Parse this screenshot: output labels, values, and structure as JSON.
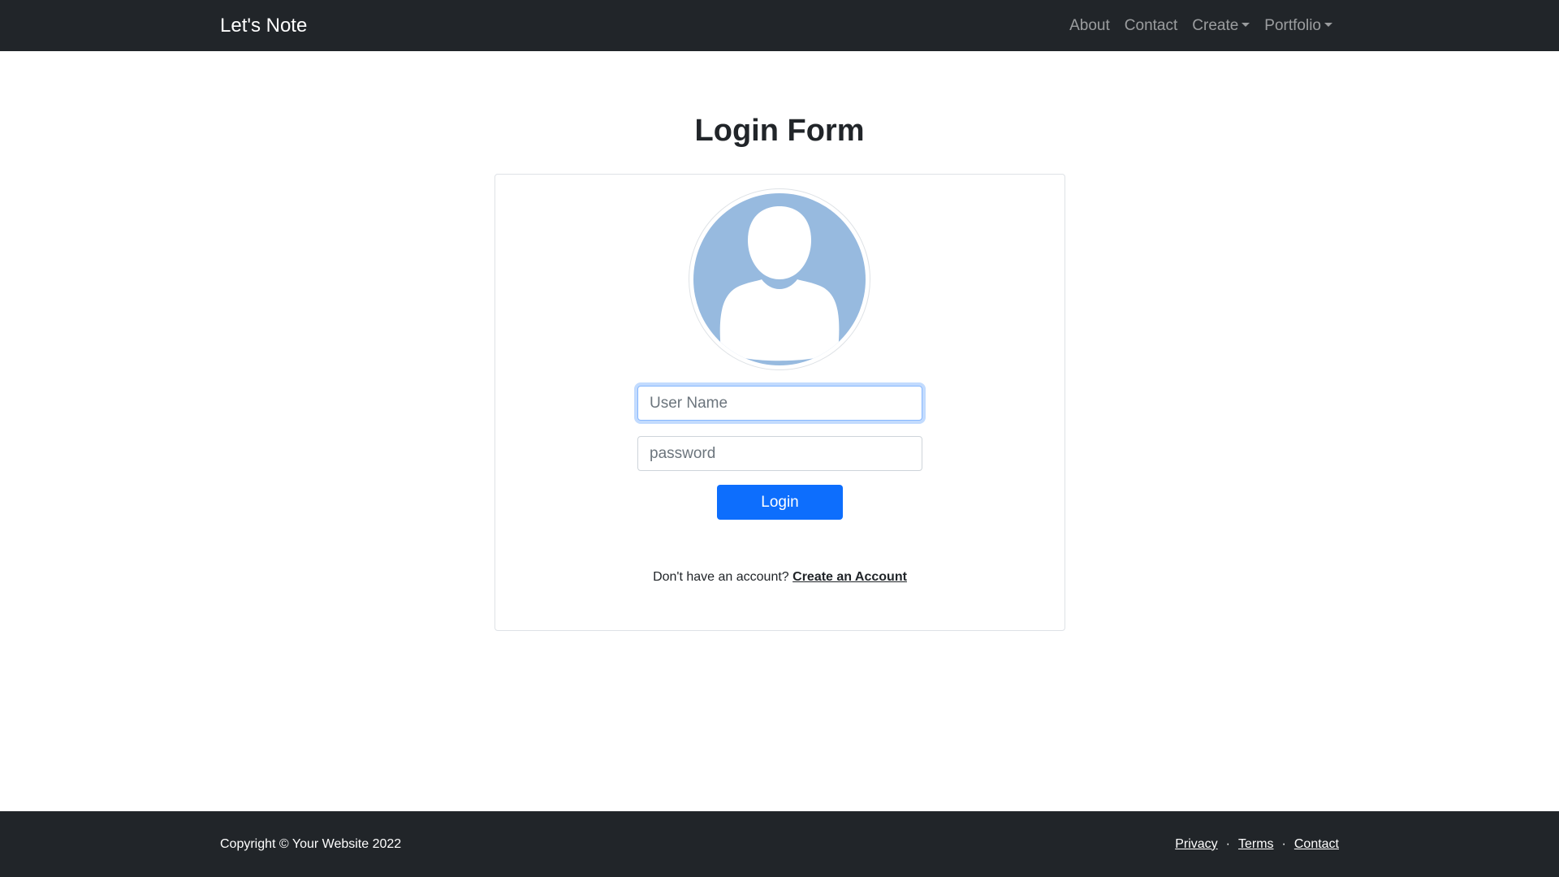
{
  "navbar": {
    "brand": "Let's Note",
    "links": [
      {
        "label": "About"
      },
      {
        "label": "Contact"
      },
      {
        "label": "Create"
      },
      {
        "label": "Portfolio"
      }
    ]
  },
  "main": {
    "title": "Login Form",
    "username_placeholder": "User Name",
    "password_placeholder": "password",
    "login_label": "Login",
    "signup_prompt": "Don't have an account?",
    "signup_link": "Create an Account",
    "avatar_icon": "user-silhouette-icon",
    "avatar_color": "#97BADF"
  },
  "footer": {
    "copyright": "Copyright © Your Website 2022",
    "links": [
      {
        "label": "Privacy"
      },
      {
        "label": "Terms"
      },
      {
        "label": "Contact"
      }
    ],
    "separator": "·"
  },
  "colors": {
    "navbar_bg": "#212529",
    "primary": "#0D6EFD",
    "footer_bg": "#212529"
  }
}
